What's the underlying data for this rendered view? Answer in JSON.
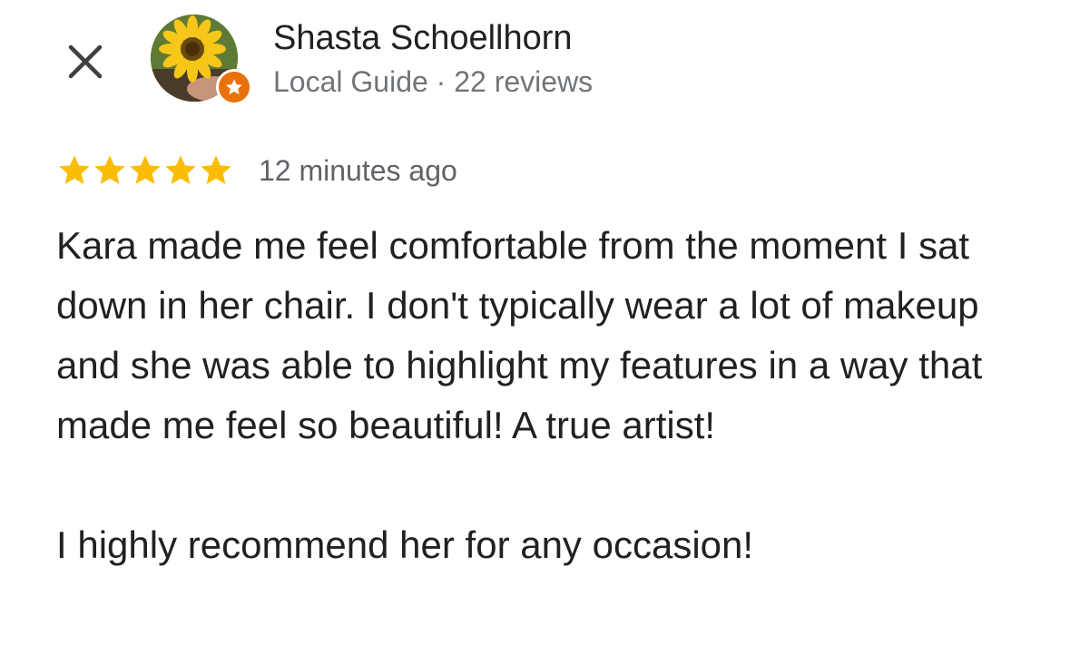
{
  "reviewer": {
    "name": "Shasta Schoellhorn",
    "meta": "Local Guide · 22 reviews",
    "avatar_icon": "sunflower-photo",
    "badge_icon": "local-guide-star-icon"
  },
  "review": {
    "rating": 5,
    "rating_max": 5,
    "time_ago": "12 minutes ago",
    "paragraph_1": "Kara made me feel comfortable from the moment I sat down in her chair. I don't typically wear a lot of makeup and she was able to highlight my features in a way that made me feel so beautiful! A true artist!",
    "paragraph_2": "I highly recommend her for any occasion!"
  },
  "colors": {
    "star": "#fbbc04",
    "badge": "#e8710a",
    "secondary_text": "#70757a"
  }
}
